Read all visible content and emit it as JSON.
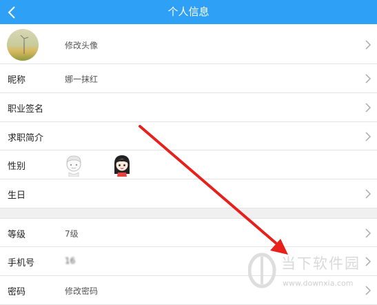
{
  "header": {
    "title": "个人信息"
  },
  "rows": {
    "avatar": {
      "value": "修改头像"
    },
    "nickname": {
      "label": "昵称",
      "value": "娜一抹红"
    },
    "signature": {
      "label": "职业签名"
    },
    "intro": {
      "label": "求职简介"
    },
    "gender": {
      "label": "性别"
    },
    "birthday": {
      "label": "生日"
    },
    "level": {
      "label": "等级",
      "value": "7级"
    },
    "phone": {
      "label": "手机号",
      "value": "16"
    },
    "password": {
      "label": "密码",
      "value": "修改密码"
    }
  },
  "watermark": {
    "text": "当下软件园",
    "url": "www.downxia.com"
  },
  "colors": {
    "header": "#2ea0f5",
    "annotation_arrow": "#e8201c"
  },
  "icons": [
    "back-arrow-icon",
    "chevron-right-icon",
    "male-avatar-icon",
    "female-avatar-icon",
    "watermark-logo-icon"
  ]
}
